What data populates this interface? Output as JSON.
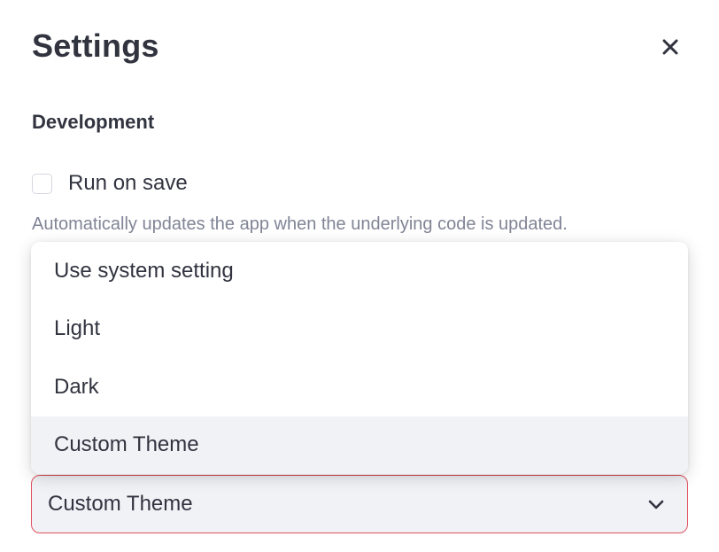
{
  "dialog": {
    "title": "Settings",
    "close_icon": "close-icon"
  },
  "development": {
    "heading": "Development",
    "run_on_save": {
      "label": "Run on save",
      "checked": false,
      "help": "Automatically updates the app when the underlying code is updated."
    }
  },
  "theme_select": {
    "options": [
      {
        "label": "Use system setting",
        "selected": false
      },
      {
        "label": "Light",
        "selected": false
      },
      {
        "label": "Dark",
        "selected": false
      },
      {
        "label": "Custom Theme",
        "selected": true
      }
    ],
    "value": "Custom Theme",
    "chevron_icon": "chevron-down-icon"
  },
  "colors": {
    "text": "#31333f",
    "muted_text": "#808495",
    "selected_bg": "#f0f2f6",
    "focus_border": "#e0525e"
  }
}
